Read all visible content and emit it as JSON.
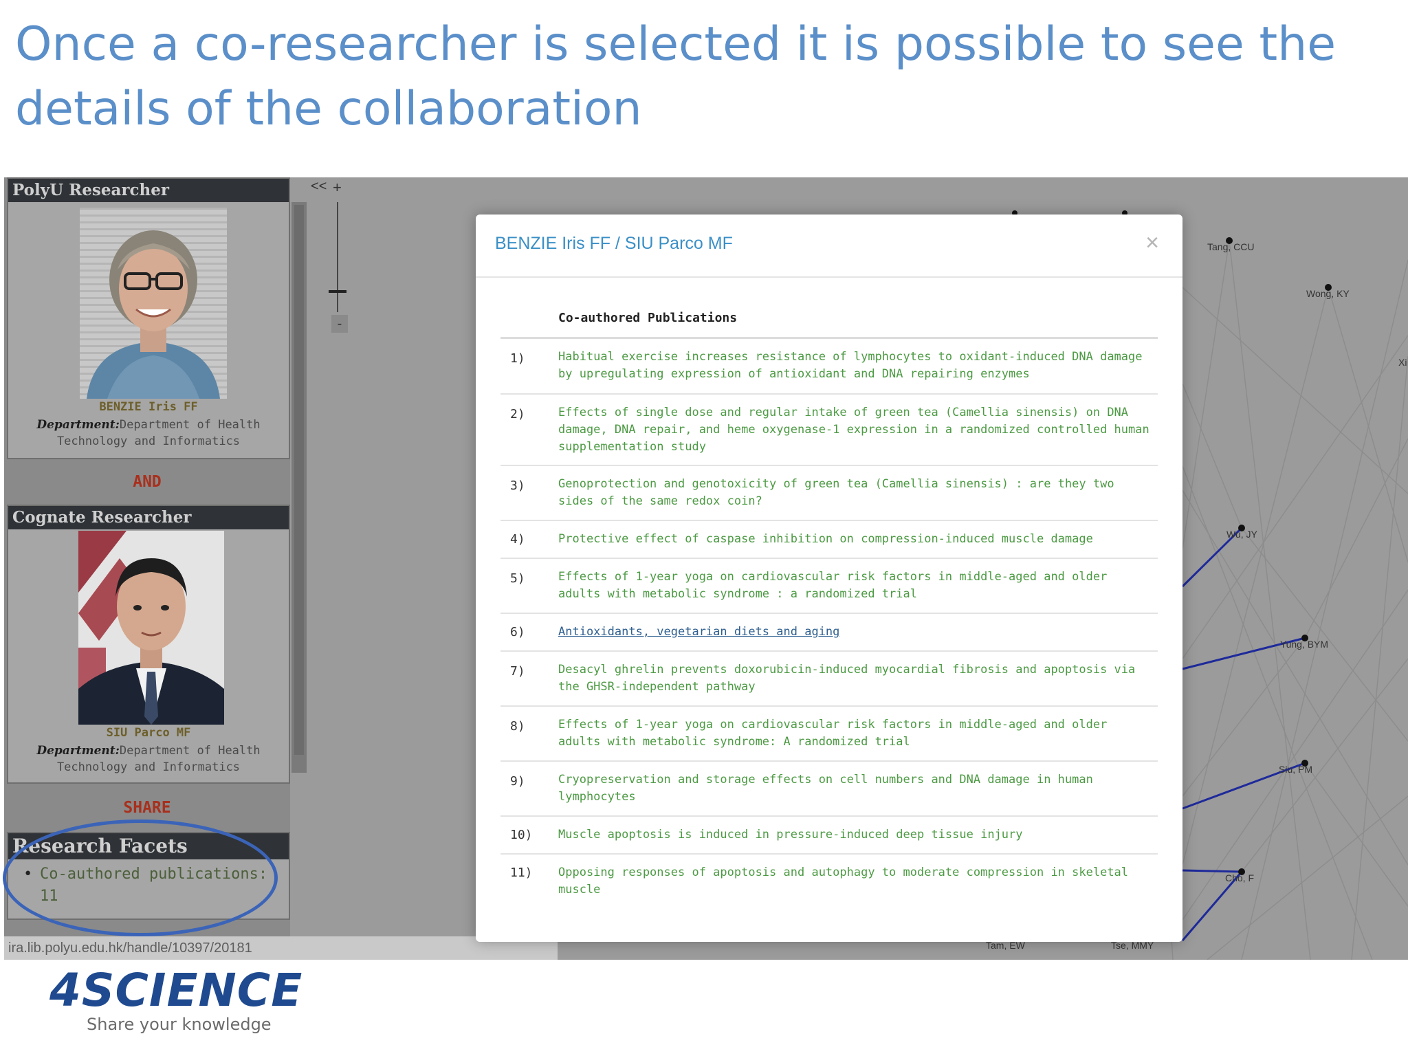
{
  "slide": {
    "title": "Once a co-researcher is selected it is possible to see the details of the collaboration"
  },
  "left_panel": {
    "polyu_header": "PolyU Researcher",
    "researcher1": {
      "name": "BENZIE Iris FF",
      "dept_label": "Department:",
      "dept_value": "Department of Health Technology and Informatics"
    },
    "and_label": "AND",
    "cognate_header": "Cognate Researcher",
    "researcher2": {
      "name": "SIU Parco MF",
      "dept_label": "Department:",
      "dept_value": "Department of Health Technology and Informatics"
    },
    "share_label": "SHARE",
    "facets_header": "Research Facets",
    "facet_item": "Co-authored publications: 11"
  },
  "status_url": "ira.lib.polyu.edu.hk/handle/10397/20181",
  "zoom": {
    "plus": "+",
    "minus": "-",
    "collapse": "<<"
  },
  "graph_labels": {
    "tang": "Tang, CCU",
    "wong": "Wong, KY",
    "wu": "Wu, JY",
    "yung": "Yung, BYM",
    "siu": "Siu, PM",
    "cho": "Cho, F",
    "tam": "Tam, EW",
    "tse": "Tse, MMY",
    "xi": "Xi"
  },
  "modal": {
    "title": "BENZIE Iris FF / SIU Parco MF",
    "close_icon": "close-icon",
    "column_header": "Co-authored Publications",
    "publications": [
      {
        "num": "1)",
        "title": "Habitual exercise increases resistance of lymphocytes to oxidant-induced DNA damage by upregulating expression of antioxidant and DNA repairing enzymes"
      },
      {
        "num": "2)",
        "title": "Effects of single dose and regular intake of green tea (Camellia sinensis) on DNA damage, DNA repair, and heme oxygenase-1 expression in a randomized controlled human supplementation study"
      },
      {
        "num": "3)",
        "title": "Genoprotection and genotoxicity of green tea (Camellia sinensis) : are they two sides of the same redox coin?"
      },
      {
        "num": "4)",
        "title": "Protective effect of caspase inhibition on compression-induced muscle damage"
      },
      {
        "num": "5)",
        "title": "Effects of 1-year yoga on cardiovascular risk factors in middle-aged and older adults with metabolic syndrome : a randomized trial"
      },
      {
        "num": "6)",
        "title": "Antioxidants, vegetarian diets and aging"
      },
      {
        "num": "7)",
        "title": "Desacyl ghrelin prevents doxorubicin-induced myocardial fibrosis and apoptosis via the GHSR-independent pathway"
      },
      {
        "num": "8)",
        "title": "Effects of 1-year yoga on cardiovascular risk factors in middle-aged and older adults with metabolic syndrome: A randomized trial"
      },
      {
        "num": "9)",
        "title": "Cryopreservation and storage effects on cell numbers and DNA damage in human lymphocytes"
      },
      {
        "num": "10)",
        "title": "Muscle apoptosis is induced in pressure-induced deep tissue injury"
      },
      {
        "num": "11)",
        "title": "Opposing responses of apoptosis and autophagy to moderate compression in skeletal muscle"
      }
    ]
  },
  "logo": {
    "main": "4SCIENCE",
    "tagline": "Share your knowledge",
    "color": "#1f4a8f"
  }
}
